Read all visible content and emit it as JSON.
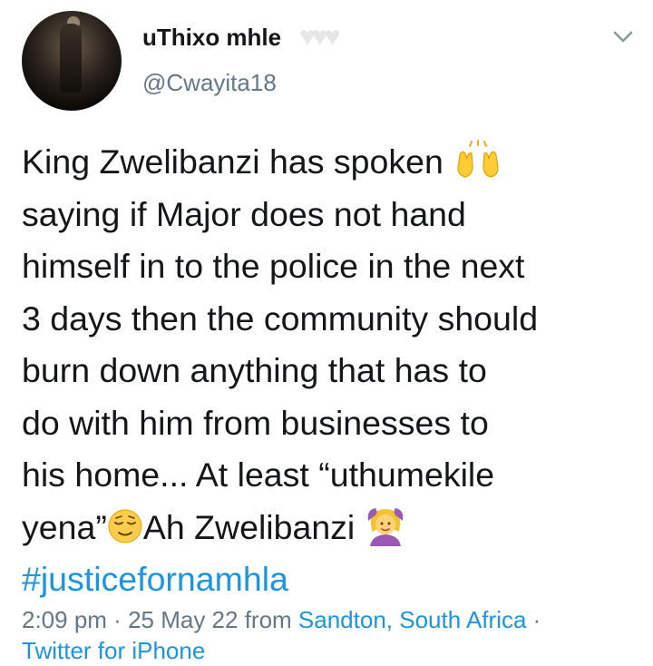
{
  "user": {
    "display_name": "uThixo mhle",
    "name_emojis": "♥♥♥",
    "handle": "@Cwayita18"
  },
  "tweet": {
    "line_1": "King Zwelibanzi has spoken",
    "line_2": "saying if Major does not hand",
    "line_3": "himself in to the police in the next",
    "line_4": "3 days then the community should",
    "line_5": "burn down anything that has to",
    "line_6": "do with him from businesses to",
    "line_7": "his home... At least “uthumekile",
    "line_8a": "yena”",
    "line_8b": "Ah Zwelibanzi",
    "hashtag": "#justicefornamhla"
  },
  "meta": {
    "time": "2:09 pm",
    "sep1": " · ",
    "date": "25 May 22",
    "from_word": " from ",
    "location": "Sandton, South Africa",
    "sep2": " ·",
    "source": "Twitter for iPhone"
  },
  "icons": {
    "hands": "raising-hands-emoji",
    "face": "relieved-face-emoji",
    "woman": "woman-gesturing-ok-emoji",
    "chevron": "chevron-down-icon"
  },
  "colors": {
    "text": "#14171a",
    "secondary": "#657786",
    "link": "#1b95e0"
  }
}
